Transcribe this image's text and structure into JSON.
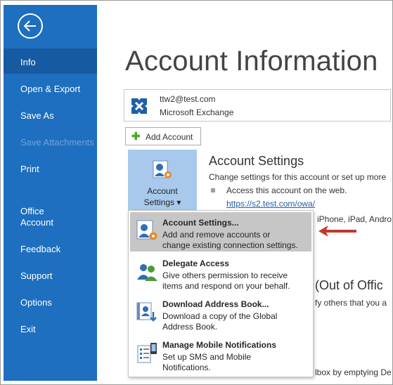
{
  "sidebar": {
    "items": [
      {
        "label": "Info"
      },
      {
        "label": "Open & Export"
      },
      {
        "label": "Save As"
      },
      {
        "label": "Save Attachments"
      },
      {
        "label": "Print"
      },
      {
        "label": "Office"
      },
      {
        "label": "Account"
      },
      {
        "label": "Feedback"
      },
      {
        "label": "Support"
      },
      {
        "label": "Options"
      },
      {
        "label": "Exit"
      }
    ]
  },
  "main": {
    "title": "Account Information",
    "account": {
      "email": "ttw2@test.com",
      "type": "Microsoft Exchange"
    },
    "add_account_label": "Add Account",
    "settings_tile": {
      "line1": "Account",
      "line2": "Settings ▾"
    },
    "account_settings": {
      "title": "Account Settings",
      "description": "Change settings for this account or set up more",
      "bullet1": "Access this account on the web.",
      "link": "https://s2.test.com/owa/",
      "partial_devices": "iPhone, iPad, Andro"
    },
    "background": {
      "ooo_heading": "(Out of Offic",
      "notify_text": "fy others that you a",
      "mailbox_text": "lbox by emptying De"
    }
  },
  "dropdown": {
    "items": [
      {
        "title": "Account Settings...",
        "desc1": "Add and remove accounts or",
        "desc2": "change existing connection settings."
      },
      {
        "title": "Delegate Access",
        "desc1": "Give others permission to receive",
        "desc2": "items and respond on your behalf."
      },
      {
        "title": "Download Address Book...",
        "desc1": "Download a copy of the Global",
        "desc2": "Address Book."
      },
      {
        "title": "Manage Mobile Notifications",
        "desc1": "Set up SMS and Mobile",
        "desc2": "Notifications."
      }
    ]
  },
  "colors": {
    "sidebar": "#1e6fbf",
    "sidebar_active": "#165aa1",
    "tile": "#a8c9ec",
    "arrow": "#c0392b",
    "link": "#1f5fa8"
  }
}
